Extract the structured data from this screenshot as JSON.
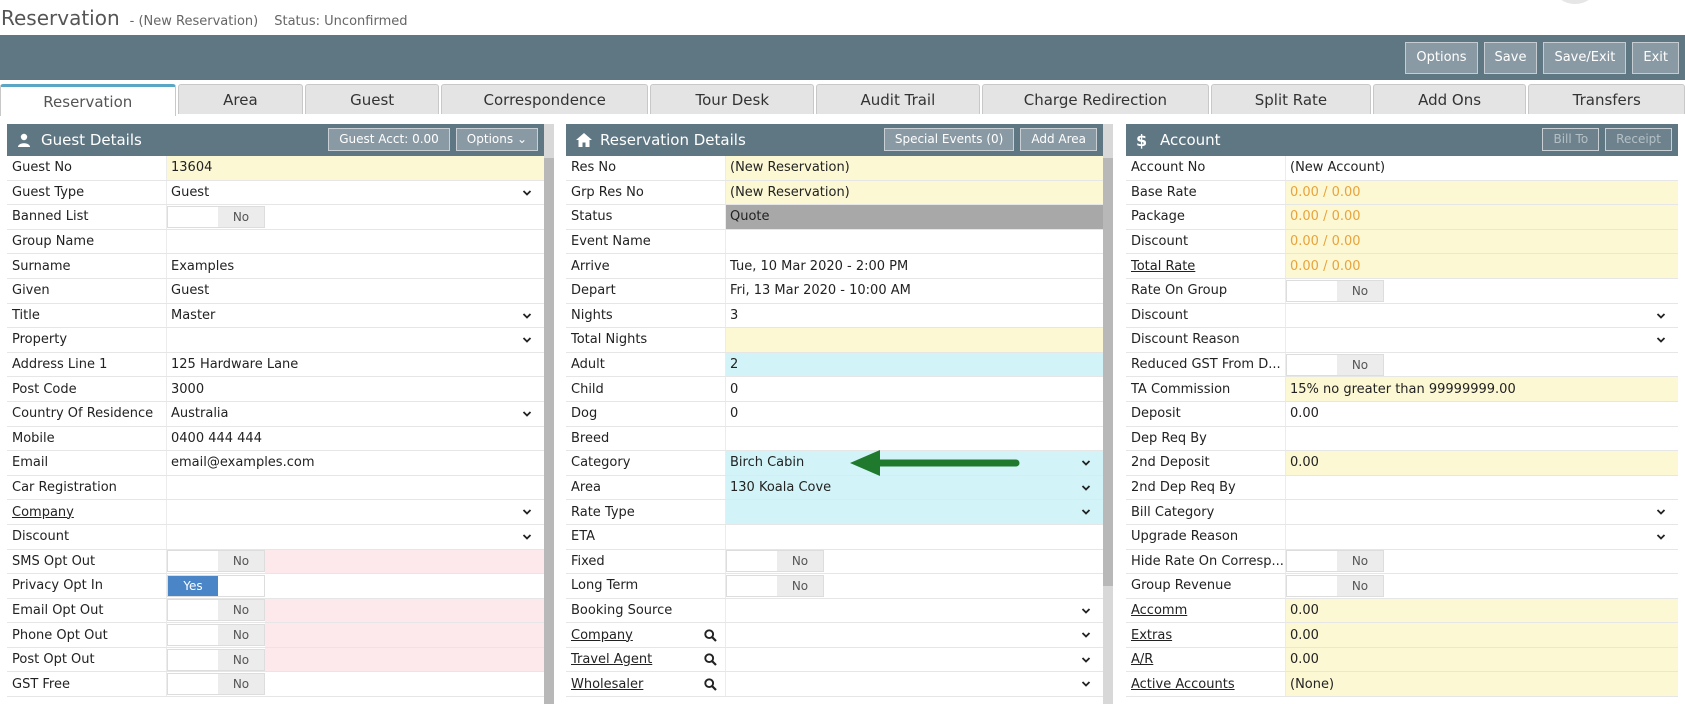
{
  "title": {
    "main": "Reservation",
    "sub": "- (New Reservation)",
    "status": "Status: Unconfirmed"
  },
  "toolbar": {
    "buttons": [
      "Options",
      "Save",
      "Save/Exit",
      "Exit"
    ]
  },
  "tabs": [
    "Reservation",
    "Area",
    "Guest",
    "Correspondence",
    "Tour Desk",
    "Audit Trail",
    "Charge Redirection",
    "Split Rate",
    "Add Ons",
    "Transfers"
  ],
  "guest": {
    "header": "Guest Details",
    "acct_button": "Guest Acct: 0.00",
    "options_button": "Options",
    "rows": [
      {
        "label": "Guest No",
        "value": "13604"
      },
      {
        "label": "Guest Type",
        "value": "Guest"
      },
      {
        "label": "Banned List",
        "value": "No"
      },
      {
        "label": "Group Name",
        "value": ""
      },
      {
        "label": "Surname",
        "value": "Examples"
      },
      {
        "label": "Given",
        "value": "Guest"
      },
      {
        "label": "Title",
        "value": "Master"
      },
      {
        "label": "Property",
        "value": ""
      },
      {
        "label": "Address Line 1",
        "value": "125 Hardware Lane"
      },
      {
        "label": "Post Code",
        "value": "3000"
      },
      {
        "label": "Country Of Residence",
        "value": "Australia"
      },
      {
        "label": "Mobile",
        "value": "0400 444 444"
      },
      {
        "label": "Email",
        "value": "email@examples.com"
      },
      {
        "label": "Car Registration",
        "value": ""
      },
      {
        "label": "Company",
        "value": ""
      },
      {
        "label": "Discount",
        "value": ""
      },
      {
        "label": "SMS Opt Out",
        "value": "No"
      },
      {
        "label": "Privacy Opt In",
        "value": "Yes"
      },
      {
        "label": "Email Opt Out",
        "value": "No"
      },
      {
        "label": "Phone Opt Out",
        "value": "No"
      },
      {
        "label": "Post Opt Out",
        "value": "No"
      },
      {
        "label": "GST Free",
        "value": "No"
      }
    ]
  },
  "reservation": {
    "header": "Reservation Details",
    "special_button": "Special Events (0)",
    "add_area_button": "Add Area",
    "rows": [
      {
        "label": "Res No",
        "value": "(New Reservation)"
      },
      {
        "label": "Grp Res No",
        "value": "(New Reservation)"
      },
      {
        "label": "Status",
        "value": "Quote"
      },
      {
        "label": "Event Name",
        "value": ""
      },
      {
        "label": "Arrive",
        "value": "Tue, 10 Mar 2020 - 2:00 PM"
      },
      {
        "label": "Depart",
        "value": "Fri, 13 Mar 2020 - 10:00 AM"
      },
      {
        "label": "Nights",
        "value": "3"
      },
      {
        "label": "Total Nights",
        "value": ""
      },
      {
        "label": "Adult",
        "value": "2"
      },
      {
        "label": "Child",
        "value": "0"
      },
      {
        "label": "Dog",
        "value": "0"
      },
      {
        "label": "Breed",
        "value": ""
      },
      {
        "label": "Category",
        "value": "Birch Cabin"
      },
      {
        "label": "Area",
        "value": "130 Koala Cove"
      },
      {
        "label": "Rate Type",
        "value": ""
      },
      {
        "label": "ETA",
        "value": ""
      },
      {
        "label": "Fixed",
        "value": "No"
      },
      {
        "label": "Long Term",
        "value": "No"
      },
      {
        "label": "Booking Source",
        "value": ""
      },
      {
        "label": "Company",
        "value": ""
      },
      {
        "label": "Travel Agent",
        "value": ""
      },
      {
        "label": "Wholesaler",
        "value": ""
      }
    ]
  },
  "account": {
    "header": "Account",
    "bill_to_button": "Bill To",
    "receipt_button": "Receipt",
    "rows": [
      {
        "label": "Account No",
        "value": "(New Account)"
      },
      {
        "label": "Base Rate",
        "value": "0.00 / 0.00"
      },
      {
        "label": "Package",
        "value": "0.00 / 0.00"
      },
      {
        "label": "Discount",
        "value": "0.00 / 0.00"
      },
      {
        "label": "Total Rate",
        "value": "0.00 / 0.00"
      },
      {
        "label": "Rate On Group",
        "value": "No"
      },
      {
        "label": "Discount",
        "value": ""
      },
      {
        "label": "Discount Reason",
        "value": ""
      },
      {
        "label": "Reduced GST From D...",
        "value": "No"
      },
      {
        "label": "TA Commission",
        "value": "15% no greater than 99999999.00"
      },
      {
        "label": "Deposit",
        "value": "0.00"
      },
      {
        "label": "Dep Req By",
        "value": ""
      },
      {
        "label": "2nd Deposit",
        "value": "0.00"
      },
      {
        "label": "2nd Dep Req By",
        "value": ""
      },
      {
        "label": "Bill Category",
        "value": ""
      },
      {
        "label": "Upgrade Reason",
        "value": ""
      },
      {
        "label": "Hide Rate On Corresp...",
        "value": "No"
      },
      {
        "label": "Group Revenue",
        "value": "No"
      },
      {
        "label": "Accomm",
        "value": "0.00"
      },
      {
        "label": "Extras",
        "value": "0.00"
      },
      {
        "label": "A/R",
        "value": "0.00"
      },
      {
        "label": "Active Accounts",
        "value": "(None)"
      }
    ]
  },
  "colors": {
    "header": "#5f7683",
    "yellow": "#fcf8d4",
    "cyan": "#d2f4f8",
    "pink": "#fde9ec",
    "yes": "#4a86c7",
    "arrow": "#1f7a2e"
  }
}
